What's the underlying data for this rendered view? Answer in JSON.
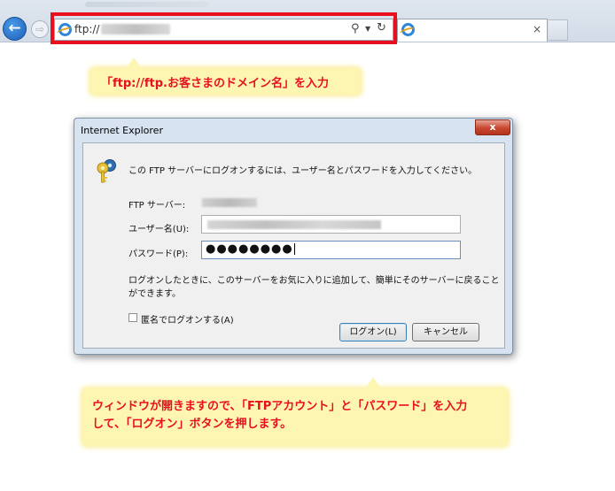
{
  "browser": {
    "address_text": "ftp://",
    "back_icon": "back-arrow-icon",
    "forward_icon": "forward-arrow-icon",
    "search_icon": "search-icon",
    "refresh_icon": "refresh-icon",
    "close_tab_glyph": "×",
    "highlight_color": "#e8101e"
  },
  "callouts": {
    "top": "「ftp://ftp.お客さまのドメイン名」を入力",
    "bottom_line1": "ウィンドウが開きますので、「FTPアカウント」と「パスワード」を入力",
    "bottom_line2": "して、「ログオン」ボタンを押します。",
    "text_color": "#e8101e",
    "bg_color": "#fdf6b2"
  },
  "dialog": {
    "title": "Internet Explorer",
    "close_glyph": "x",
    "message": "この FTP サーバーにログオンするには、ユーザー名とパスワードを入力してください。",
    "ftp_server_label": "FTP サーバー:",
    "username_label": "ユーザー名(U):",
    "password_label": "パスワード(P):",
    "password_value": "●●●●●●●●",
    "note": "ログオンしたときに、このサーバーをお気に入りに追加して、簡単にそのサーバーに戻ることができます。",
    "anonymous_label": "匿名でログオンする(A)",
    "logon_button": "ログオン(L)",
    "cancel_button": "キャンセル"
  }
}
